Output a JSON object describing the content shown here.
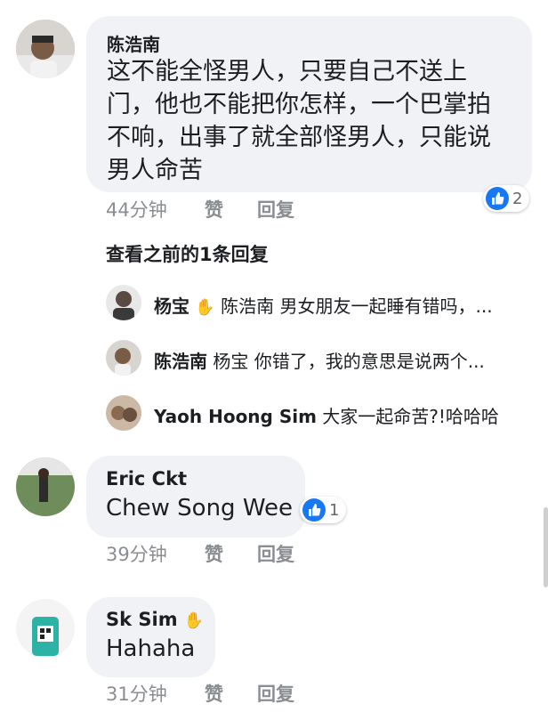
{
  "comments": [
    {
      "author": "陈浩南",
      "lines": [
        "这不能全怪男人，只要自己不送上",
        "门，他也不能把你怎样，一个巴掌拍",
        "不响，出事了就全部怪男人，只能说",
        "男人命苦"
      ],
      "likes": "2",
      "time": "44分钟",
      "like_label": "赞",
      "reply_label": "回复"
    },
    {
      "author": "Eric Ckt",
      "text": "Chew Song Wee",
      "likes": "1",
      "time": "39分钟",
      "like_label": "赞",
      "reply_label": "回复"
    },
    {
      "author": "Sk Sim",
      "text": "Hahaha",
      "time": "31分钟",
      "like_label": "赞",
      "reply_label": "回复"
    }
  ],
  "view_previous": "查看之前的1条回复",
  "replies": [
    {
      "author": "杨宝",
      "text": "陈浩南 男女朋友一起睡有错吗，..."
    },
    {
      "author": "陈浩南",
      "text": "杨宝 你错了，我的意思是说两个..."
    },
    {
      "author": "Yaoh Hoong Sim",
      "text": "大家一起命苦?!哈哈哈"
    }
  ],
  "icons": {
    "like": "thumbs-up-icon",
    "wave": "waving-hand-icon"
  },
  "colors": {
    "bubble": "#f0f2f5",
    "like_blue": "#1877f2",
    "meta": "#8a8d91"
  }
}
